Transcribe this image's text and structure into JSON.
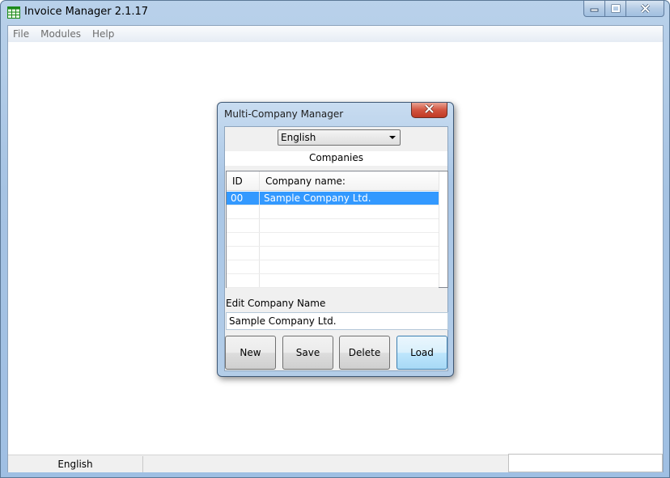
{
  "window": {
    "title": "Invoice Manager 2.1.17",
    "icon": "spreadsheet-icon",
    "controls": [
      "minimize-icon",
      "maximize-icon",
      "close-icon"
    ]
  },
  "menu": {
    "items": [
      {
        "label": "File"
      },
      {
        "label": "Modules"
      },
      {
        "label": "Help"
      }
    ]
  },
  "dialog": {
    "title": "Multi-Company Manager",
    "language_select": {
      "selected": "English"
    },
    "companies_label": "Companies",
    "grid": {
      "columns": [
        "ID",
        "Company name:"
      ],
      "rows": [
        {
          "id": "00",
          "name": "Sample Company Ltd.",
          "selected": true
        }
      ],
      "empty_rows": 6
    },
    "edit_label": "Edit Company Name",
    "edit_value": "Sample Company Ltd.",
    "buttons": {
      "new": "New",
      "save": "Save",
      "delete": "Delete",
      "load": "Load"
    }
  },
  "status_bar": {
    "language": "English",
    "middle": "",
    "right": ""
  },
  "colors": {
    "selection": "#3399ff",
    "title_bar": "#a9c6e6",
    "dialog_close": "#c8462f"
  }
}
